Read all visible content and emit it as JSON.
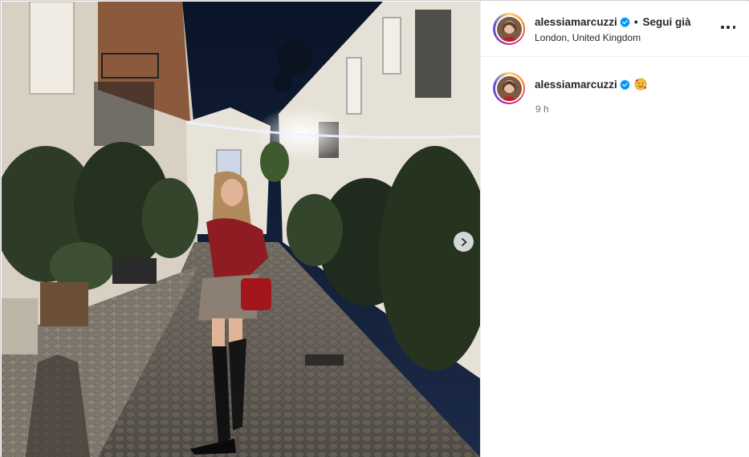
{
  "post": {
    "media_alt": "",
    "next_icon": "chevron-right-icon"
  },
  "header": {
    "username": "alessiamarcuzzi",
    "separator": "•",
    "follow_label": "Segui già",
    "location": "London, United Kingdom",
    "more_icon": "more-horizontal-icon"
  },
  "caption": {
    "username": "alessiamarcuzzi",
    "emoji": "🥰",
    "time": "9 h"
  },
  "colors": {
    "verified": "#0095f6",
    "text": "#262626",
    "muted": "#737373"
  }
}
